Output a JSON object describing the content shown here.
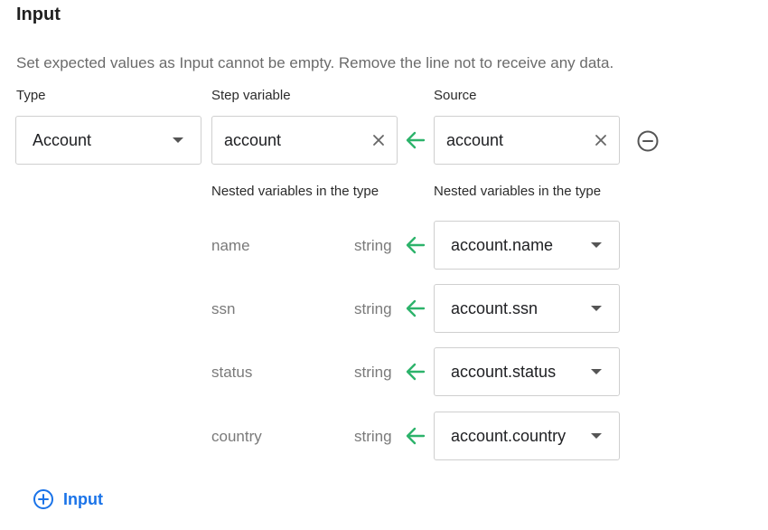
{
  "header": {
    "title": "Input"
  },
  "description": "Set expected values as Input cannot be empty. Remove the line not to receive any data.",
  "columns": {
    "type": "Type",
    "step_variable": "Step variable",
    "source": "Source"
  },
  "row": {
    "type_value": "Account",
    "step_variable_value": "account",
    "source_value": "account"
  },
  "nested": {
    "left_header": "Nested variables in the type",
    "right_header": "Nested variables in the type",
    "items": [
      {
        "name": "name",
        "type": "string",
        "source": "account.name"
      },
      {
        "name": "ssn",
        "type": "string",
        "source": "account.ssn"
      },
      {
        "name": "status",
        "type": "string",
        "source": "account.status"
      },
      {
        "name": "country",
        "type": "string",
        "source": "account.country"
      }
    ]
  },
  "add_button": {
    "label": "Input"
  },
  "colors": {
    "accent": "#1a73e8",
    "arrow": "#2db36b",
    "border": "#cfcfcf",
    "muted": "#7a7a7a"
  },
  "icons": {
    "clear": "close-icon",
    "remove": "minus-circle-icon",
    "add": "plus-circle-icon",
    "mapping": "arrow-left-icon",
    "dropdown": "chevron-down-icon"
  }
}
